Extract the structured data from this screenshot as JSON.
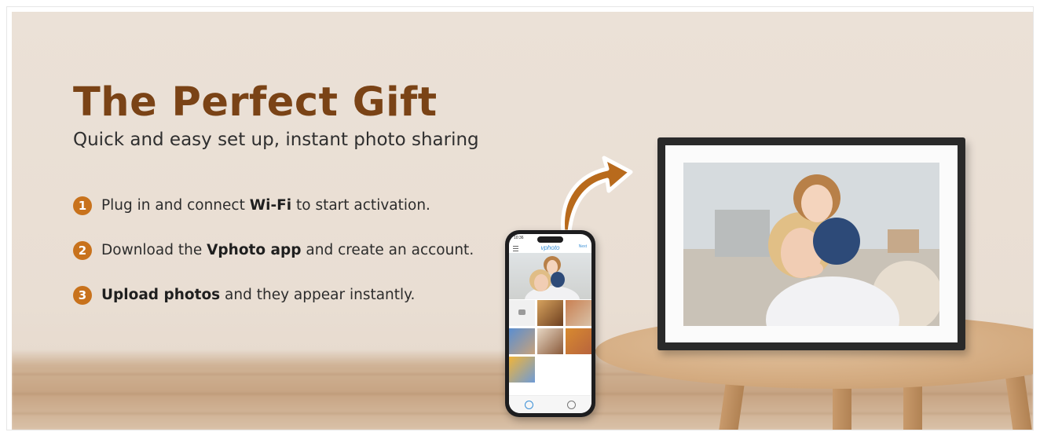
{
  "banner": {
    "title": "The Perfect Gift",
    "subtitle": "Quick and easy set up, instant photo sharing",
    "accent_color": "#c8721c",
    "title_color": "#7a4316",
    "steps": [
      {
        "number": "1",
        "before": "Plug in and connect ",
        "bold": "Wi-Fi",
        "after": " to start activation."
      },
      {
        "number": "2",
        "before": "Download the ",
        "bold": "Vphoto app",
        "after": " and create an account."
      },
      {
        "number": "3",
        "before": "",
        "bold": "Upload photos",
        "after": " and they appear instantly."
      }
    ]
  },
  "phone": {
    "time": "10:36",
    "app_name": "vphoto",
    "header_link": "Next"
  },
  "icons": {
    "arrow": "curved-arrow-icon",
    "camera": "camera-icon"
  }
}
